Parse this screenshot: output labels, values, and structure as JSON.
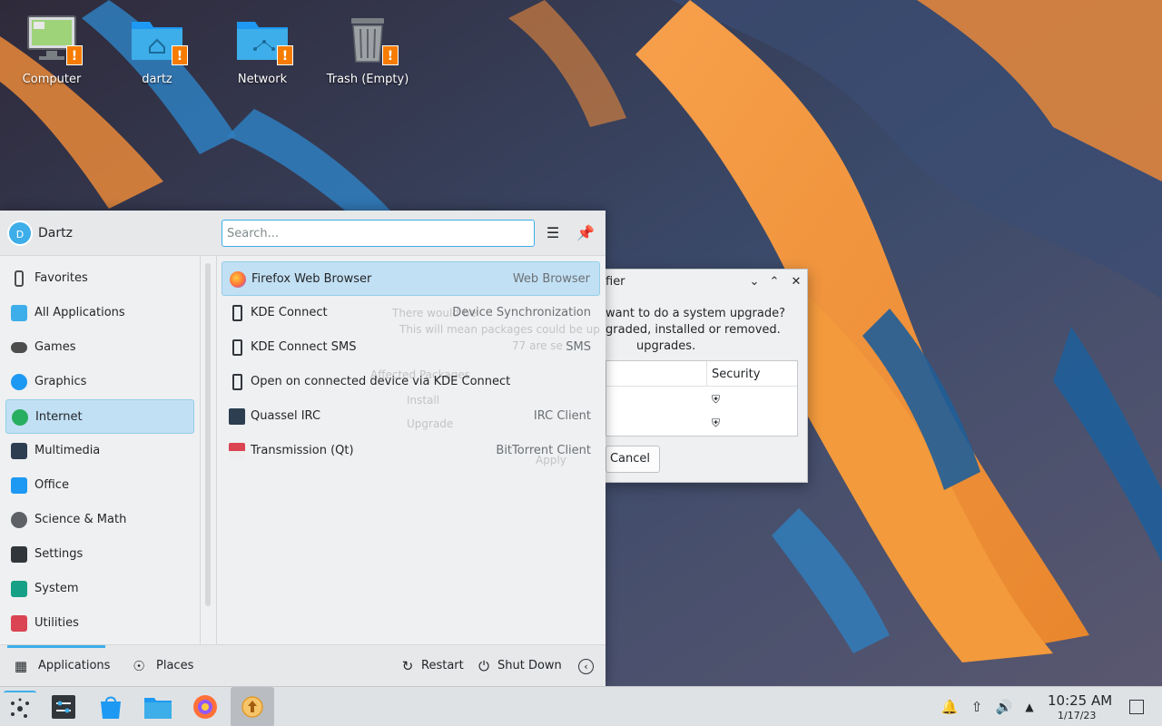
{
  "desktop": {
    "icons": [
      {
        "label": "Computer",
        "icon": "computer-icon"
      },
      {
        "label": "dartz",
        "icon": "home-folder-icon"
      },
      {
        "label": "Network",
        "icon": "network-folder-icon"
      },
      {
        "label": "Trash (Empty)",
        "icon": "trash-icon"
      }
    ],
    "badge_glyph": "!"
  },
  "updater_dialog": {
    "title_fragment": "fier",
    "message_lines": [
      "want to do a system upgrade?",
      "graded, installed or removed.",
      "upgrades."
    ],
    "column_header": "Security",
    "cancel_label": "Cancel",
    "ghost_texts": [
      "There would be",
      "This will mean packages could be up",
      "77 are se",
      "Affected Packages",
      "Install",
      "Upgrade",
      "Apply"
    ]
  },
  "launcher": {
    "user": {
      "initial": "D",
      "name": "Dartz"
    },
    "search": {
      "placeholder": "Search..."
    },
    "categories": [
      {
        "label": "Favorites",
        "icon": "bookmark-icon",
        "active": false
      },
      {
        "label": "All Applications",
        "icon": "grid-icon",
        "active": false
      },
      {
        "label": "Games",
        "icon": "gamepad-icon",
        "active": false
      },
      {
        "label": "Graphics",
        "icon": "graphics-icon",
        "active": false
      },
      {
        "label": "Internet",
        "icon": "globe-icon",
        "active": true
      },
      {
        "label": "Multimedia",
        "icon": "multimedia-icon",
        "active": false
      },
      {
        "label": "Office",
        "icon": "office-icon",
        "active": false
      },
      {
        "label": "Science & Math",
        "icon": "science-icon",
        "active": false
      },
      {
        "label": "Settings",
        "icon": "settings-icon",
        "active": false
      },
      {
        "label": "System",
        "icon": "system-icon",
        "active": false
      },
      {
        "label": "Utilities",
        "icon": "toolbox-icon",
        "active": false
      }
    ],
    "apps": [
      {
        "name": "Firefox Web Browser",
        "desc": "Web Browser",
        "icon": "firefox-icon",
        "active": true
      },
      {
        "name": "KDE Connect",
        "desc": "Device Synchronization",
        "icon": "phone-icon",
        "active": false
      },
      {
        "name": "KDE Connect SMS",
        "desc": "SMS",
        "icon": "phone-icon",
        "active": false
      },
      {
        "name": "Open on connected device via KDE Connect",
        "desc": "",
        "icon": "phone-icon",
        "active": false
      },
      {
        "name": "Quassel IRC",
        "desc": "IRC Client",
        "icon": "irc-icon",
        "active": false
      },
      {
        "name": "Transmission (Qt)",
        "desc": "BitTorrent Client",
        "icon": "transmission-icon",
        "active": false
      }
    ],
    "footer": {
      "applications": "Applications",
      "places": "Places",
      "restart": "Restart",
      "shutdown": "Shut Down"
    }
  },
  "taskbar": {
    "clock_time": "10:25 AM",
    "clock_date": "1/17/23"
  },
  "colors": {
    "accent": "#3daee9",
    "active_bg": "#c2e0f4",
    "warning_badge": "#f57c00"
  }
}
